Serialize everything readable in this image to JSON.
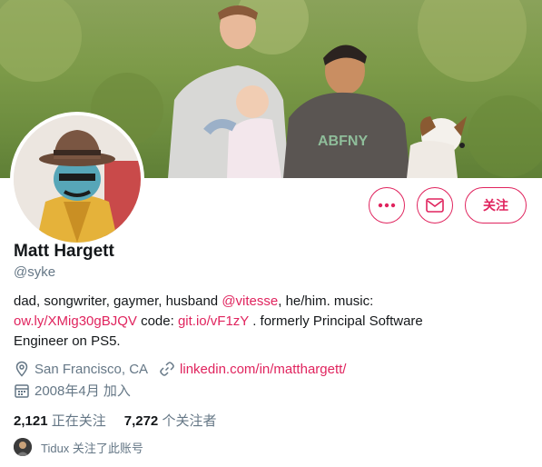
{
  "profile": {
    "name": "Matt Hargett",
    "handle": "@syke",
    "bio": {
      "part1": "dad, songwriter, gaymer, husband ",
      "mention": "@vitesse",
      "part2": ", he/him. music:",
      "link1": "ow.ly/XMig30gBJQV",
      "part3": " code: ",
      "link2": "git.io/vF1zY",
      "part4": " . formerly Principal Software",
      "line3": "Engineer on PS5."
    },
    "location": "San Francisco, CA",
    "website": "linkedin.com/in/matthargett/",
    "joined": "2008年4月 加入"
  },
  "actions": {
    "follow_label": "关注"
  },
  "stats": {
    "following_count": "2,121",
    "following_label": "正在关注",
    "followers_count": "7,272",
    "followers_label": "个关注者"
  },
  "followed_by": {
    "text": "Tidux 关注了此账号"
  },
  "colors": {
    "accent": "#e0245e",
    "secondary_text": "#657786",
    "primary_text": "#14171a"
  },
  "icons": {
    "more": "more-icon",
    "message": "mail-icon",
    "location": "location-icon",
    "link": "link-icon",
    "calendar": "calendar-icon"
  }
}
